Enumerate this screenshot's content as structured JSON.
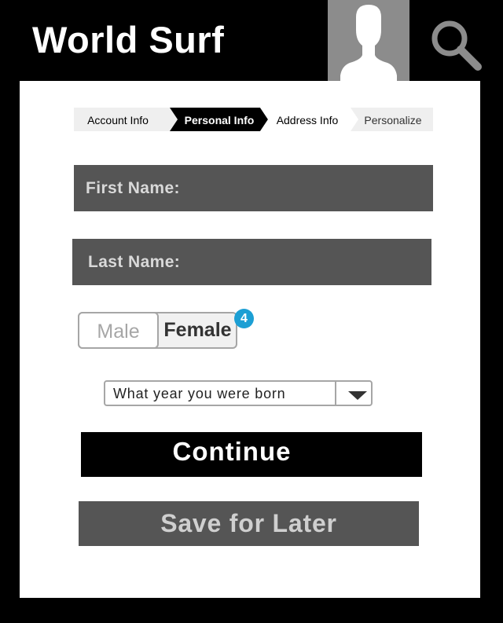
{
  "header": {
    "title": "World Surf",
    "avatar_icon": "user-avatar-icon",
    "search_icon": "search-icon"
  },
  "steps": [
    {
      "label": "Account Info",
      "state": "done"
    },
    {
      "label": "Personal Info",
      "state": "active"
    },
    {
      "label": "Address Info",
      "state": "todo"
    },
    {
      "label": "Personalize",
      "state": "todo"
    }
  ],
  "form": {
    "first_name_label": "First Name:",
    "last_name_label": "Last Name:",
    "gender": {
      "options": [
        "Male",
        "Female"
      ],
      "selected": "Female",
      "badge": "4"
    },
    "birth_year": {
      "value": "What year you were born",
      "icon": "chevron-down-icon"
    },
    "continue_label": "Continue",
    "save_label": "Save for Later"
  },
  "colors": {
    "background": "#000000",
    "card": "#ffffff",
    "field": "#555555",
    "badge": "#1c9fd4",
    "step_active": "#000000",
    "step_inactive": "#efefef"
  }
}
